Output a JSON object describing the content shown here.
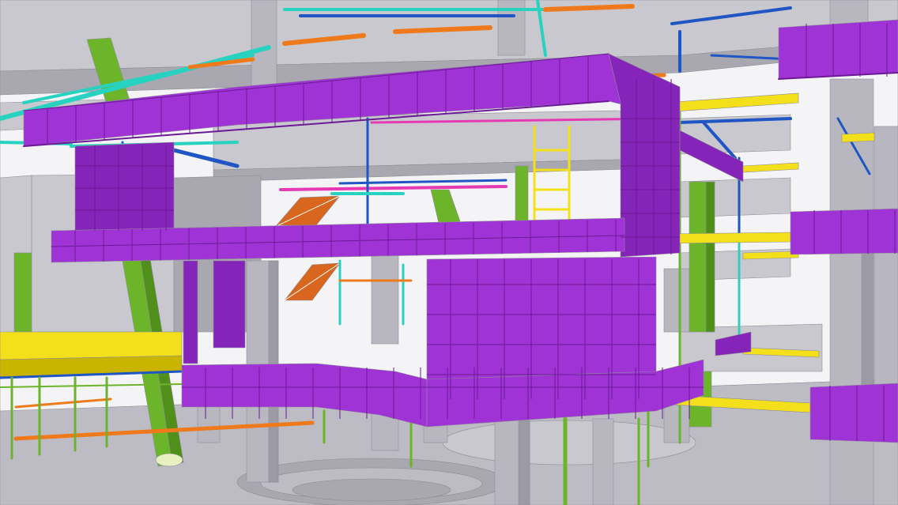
{
  "scene": {
    "kind": "3d-bim-structural-model-render",
    "colors": {
      "sky": "#f4f4f6",
      "slab": "#c9c8ce",
      "slab_dark": "#a9a8b0",
      "slab_edge": "#8e8d96",
      "concrete_column": "#b8b7c0",
      "concrete_column_shade": "#9c9ba5",
      "facade_panel": "#a033d6",
      "facade_panel_shade": "#8424b8",
      "facade_grid": "#6b1a96",
      "steel_yellow": "#f3e01a",
      "steel_yellow_shade": "#c9b400",
      "steel_green": "#6cb52a",
      "steel_green_shade": "#4f8f1a",
      "pipe_cyan": "#27d3c0",
      "pipe_blue": "#1f56c4",
      "pipe_orange": "#ef7a1c",
      "pipe_magenta": "#e63ab4",
      "stair_orange": "#d8661e",
      "ground": "#bdbcc4"
    },
    "elements": [
      "upper-slab",
      "upper-purple-facade-band",
      "middle-purple-facade-band",
      "lower-curved-purple-facade",
      "purple-facade-tower",
      "right-purple-balcony-upper",
      "right-purple-balcony-mid",
      "right-purple-balcony-lower",
      "concrete-columns",
      "green-diagonal-columns",
      "yellow-steel-deck",
      "yellow-cantilever-beams",
      "orange-staircase",
      "yellow-ladder",
      "mep-piping",
      "ground-floor-paving"
    ]
  }
}
